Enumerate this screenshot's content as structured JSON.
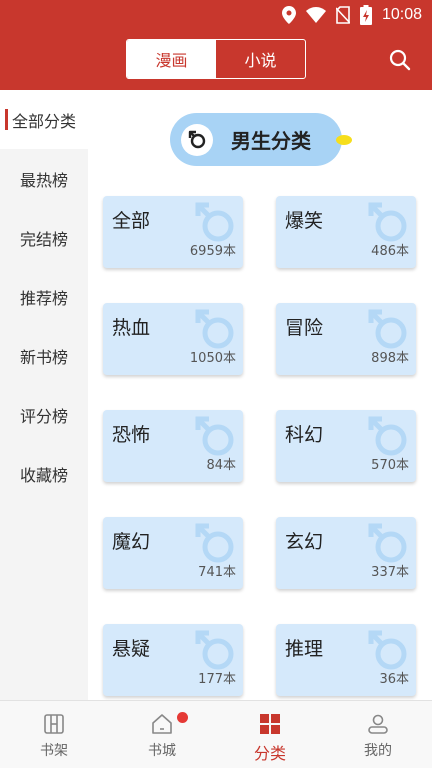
{
  "status": {
    "time": "10:08"
  },
  "header": {
    "tabs": [
      {
        "label": "漫画",
        "active": true
      },
      {
        "label": "小说",
        "active": false
      }
    ],
    "accent": "#c8372d"
  },
  "sidebar": {
    "items": [
      {
        "label": "全部分类",
        "active": true
      },
      {
        "label": "最热榜"
      },
      {
        "label": "完结榜"
      },
      {
        "label": "推荐榜"
      },
      {
        "label": "新书榜"
      },
      {
        "label": "评分榜"
      },
      {
        "label": "收藏榜"
      }
    ]
  },
  "section": {
    "title": "男生分类"
  },
  "categories": [
    {
      "name": "全部",
      "count": "6959本"
    },
    {
      "name": "爆笑",
      "count": "486本"
    },
    {
      "name": "热血",
      "count": "1050本"
    },
    {
      "name": "冒险",
      "count": "898本"
    },
    {
      "name": "恐怖",
      "count": "84本"
    },
    {
      "name": "科幻",
      "count": "570本"
    },
    {
      "name": "魔幻",
      "count": "741本"
    },
    {
      "name": "玄幻",
      "count": "337本"
    },
    {
      "name": "悬疑",
      "count": "177本"
    },
    {
      "name": "推理",
      "count": "36本"
    }
  ],
  "bottomnav": {
    "items": [
      {
        "label": "书架",
        "icon": "bookshelf-icon"
      },
      {
        "label": "书城",
        "icon": "home-icon",
        "badge": true
      },
      {
        "label": "分类",
        "icon": "category-icon",
        "active": true
      },
      {
        "label": "我的",
        "icon": "profile-icon"
      }
    ]
  }
}
